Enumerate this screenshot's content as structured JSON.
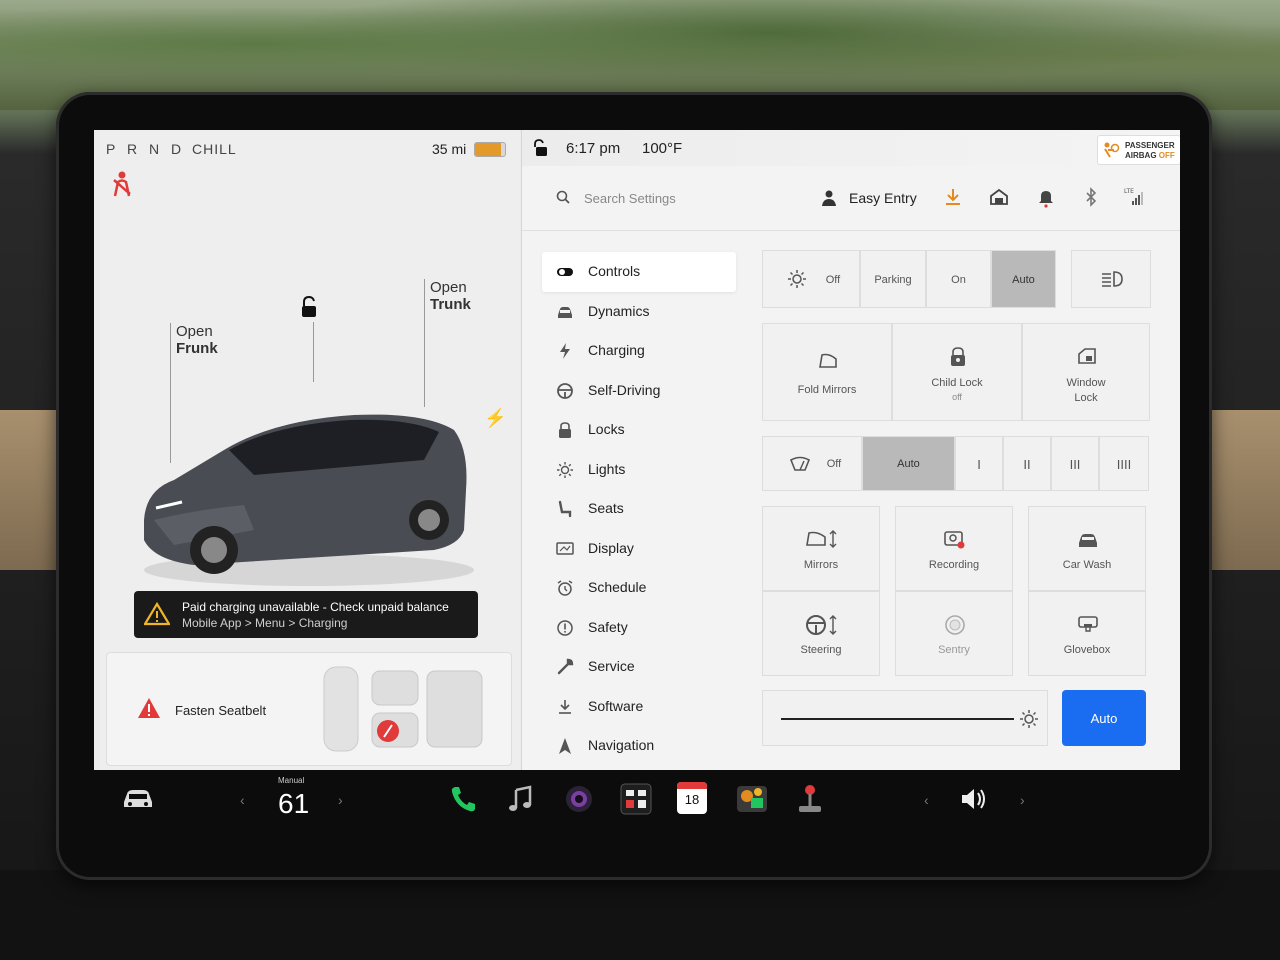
{
  "status": {
    "gear": "P R N D",
    "drive_mode": "CHILL",
    "range": "35 mi",
    "battery_level": 0.85
  },
  "car_view": {
    "frunk_open_1": "Open",
    "frunk_open_2": "Frunk",
    "trunk_open_1": "Open",
    "trunk_open_2": "Trunk"
  },
  "alert": {
    "title": "Paid charging unavailable - Check unpaid balance",
    "subtitle": "Mobile App > Menu > Charging"
  },
  "seatbelt": {
    "label": "Fasten Seatbelt"
  },
  "topbar": {
    "time": "6:17 pm",
    "temperature": "100°F",
    "airbag_line1": "PASSENGER",
    "airbag_line2": "AIRBAG",
    "airbag_state": "OFF"
  },
  "search": {
    "placeholder": "Search Settings"
  },
  "profile": {
    "name": "Easy Entry"
  },
  "menu": [
    {
      "label": "Controls",
      "icon": "toggle-icon"
    },
    {
      "label": "Dynamics",
      "icon": "car-icon"
    },
    {
      "label": "Charging",
      "icon": "bolt-icon"
    },
    {
      "label": "Self-Driving",
      "icon": "steering-wheel-icon"
    },
    {
      "label": "Locks",
      "icon": "lock-icon"
    },
    {
      "label": "Lights",
      "icon": "sun-icon"
    },
    {
      "label": "Seats",
      "icon": "seat-icon"
    },
    {
      "label": "Display",
      "icon": "display-icon"
    },
    {
      "label": "Schedule",
      "icon": "alarm-clock-icon"
    },
    {
      "label": "Safety",
      "icon": "alert-circle-icon"
    },
    {
      "label": "Service",
      "icon": "wrench-icon"
    },
    {
      "label": "Software",
      "icon": "download-icon"
    },
    {
      "label": "Navigation",
      "icon": "navigation-arrow-icon"
    }
  ],
  "lights": {
    "off": "Off",
    "parking": "Parking",
    "on": "On",
    "auto": "Auto",
    "selected": "Auto"
  },
  "row2": {
    "fold_mirrors": "Fold Mirrors",
    "child_lock": "Child Lock",
    "child_lock_state": "off",
    "window_lock_1": "Window",
    "window_lock_2": "Lock"
  },
  "wipers": {
    "off": "Off",
    "auto": "Auto",
    "s1": "I",
    "s2": "II",
    "s3": "III",
    "s4": "IIII",
    "selected": "Auto"
  },
  "grid": {
    "mirrors": "Mirrors",
    "recording": "Recording",
    "car_wash": "Car Wash",
    "steering": "Steering",
    "sentry": "Sentry",
    "glovebox": "Glovebox"
  },
  "brightness": {
    "auto_label": "Auto",
    "level": 0.97
  },
  "taskbar": {
    "speed_mode": "Manual",
    "speed": "61",
    "calendar_day": "18"
  },
  "colors": {
    "accent_blue": "#1a6cf0",
    "alert_red": "#e03a3a",
    "warning_orange": "#e39a2a",
    "phone_green": "#22c55e"
  }
}
